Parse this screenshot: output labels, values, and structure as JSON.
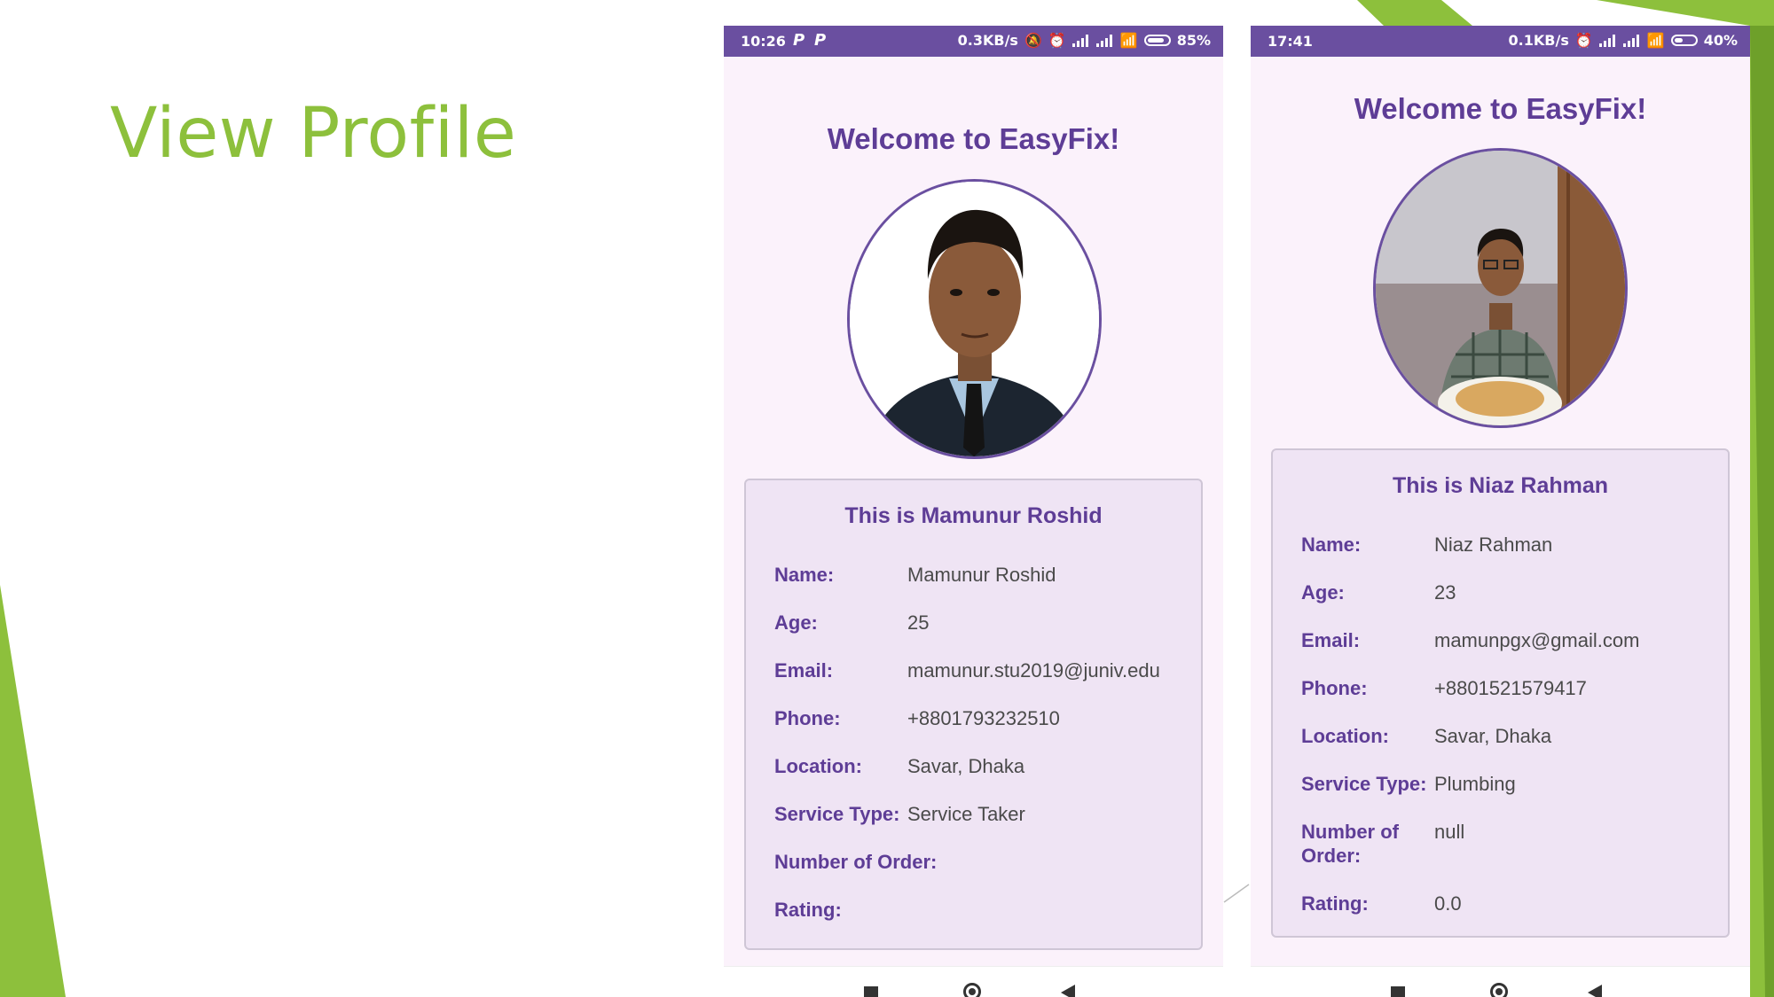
{
  "slide": {
    "title": "View Profile"
  },
  "colors": {
    "accent_green": "#8dc03c",
    "statusbar_purple": "#6a4fa0",
    "text_purple": "#5e3d96"
  },
  "phones": [
    {
      "status": {
        "time": "10:26",
        "speed": "0.3KB/s",
        "battery": "85%",
        "battery_level": 0.85,
        "charging": true
      },
      "welcome": "Welcome to EasyFix!",
      "card_title": "This is Mamunur Roshid",
      "fields": [
        {
          "label": "Name:",
          "value": "Mamunur Roshid"
        },
        {
          "label": "Age:",
          "value": "25"
        },
        {
          "label": "Email:",
          "value": "mamunur.stu2019@juniv.edu"
        },
        {
          "label": "Phone:",
          "value": "+8801793232510"
        },
        {
          "label": "Location:",
          "value": "Savar, Dhaka"
        },
        {
          "label": "Service Type:",
          "value": "Service Taker"
        },
        {
          "label": "Number of Order:",
          "value": ""
        },
        {
          "label": "Rating:",
          "value": ""
        }
      ]
    },
    {
      "status": {
        "time": "17:41",
        "speed": "0.1KB/s",
        "battery": "40%",
        "battery_level": 0.4,
        "charging": false
      },
      "welcome": "Welcome to EasyFix!",
      "card_title": "This is Niaz Rahman",
      "fields": [
        {
          "label": "Name:",
          "value": "Niaz Rahman"
        },
        {
          "label": "Age:",
          "value": "23"
        },
        {
          "label": "Email:",
          "value": "mamunpgx@gmail.com"
        },
        {
          "label": "Phone:",
          "value": "+8801521579417"
        },
        {
          "label": "Location:",
          "value": "Savar, Dhaka"
        },
        {
          "label": "Service Type:",
          "value": "Plumbing"
        },
        {
          "label": "Number of Order:",
          "value": "null"
        },
        {
          "label": "Rating:",
          "value": "0.0"
        }
      ]
    }
  ]
}
